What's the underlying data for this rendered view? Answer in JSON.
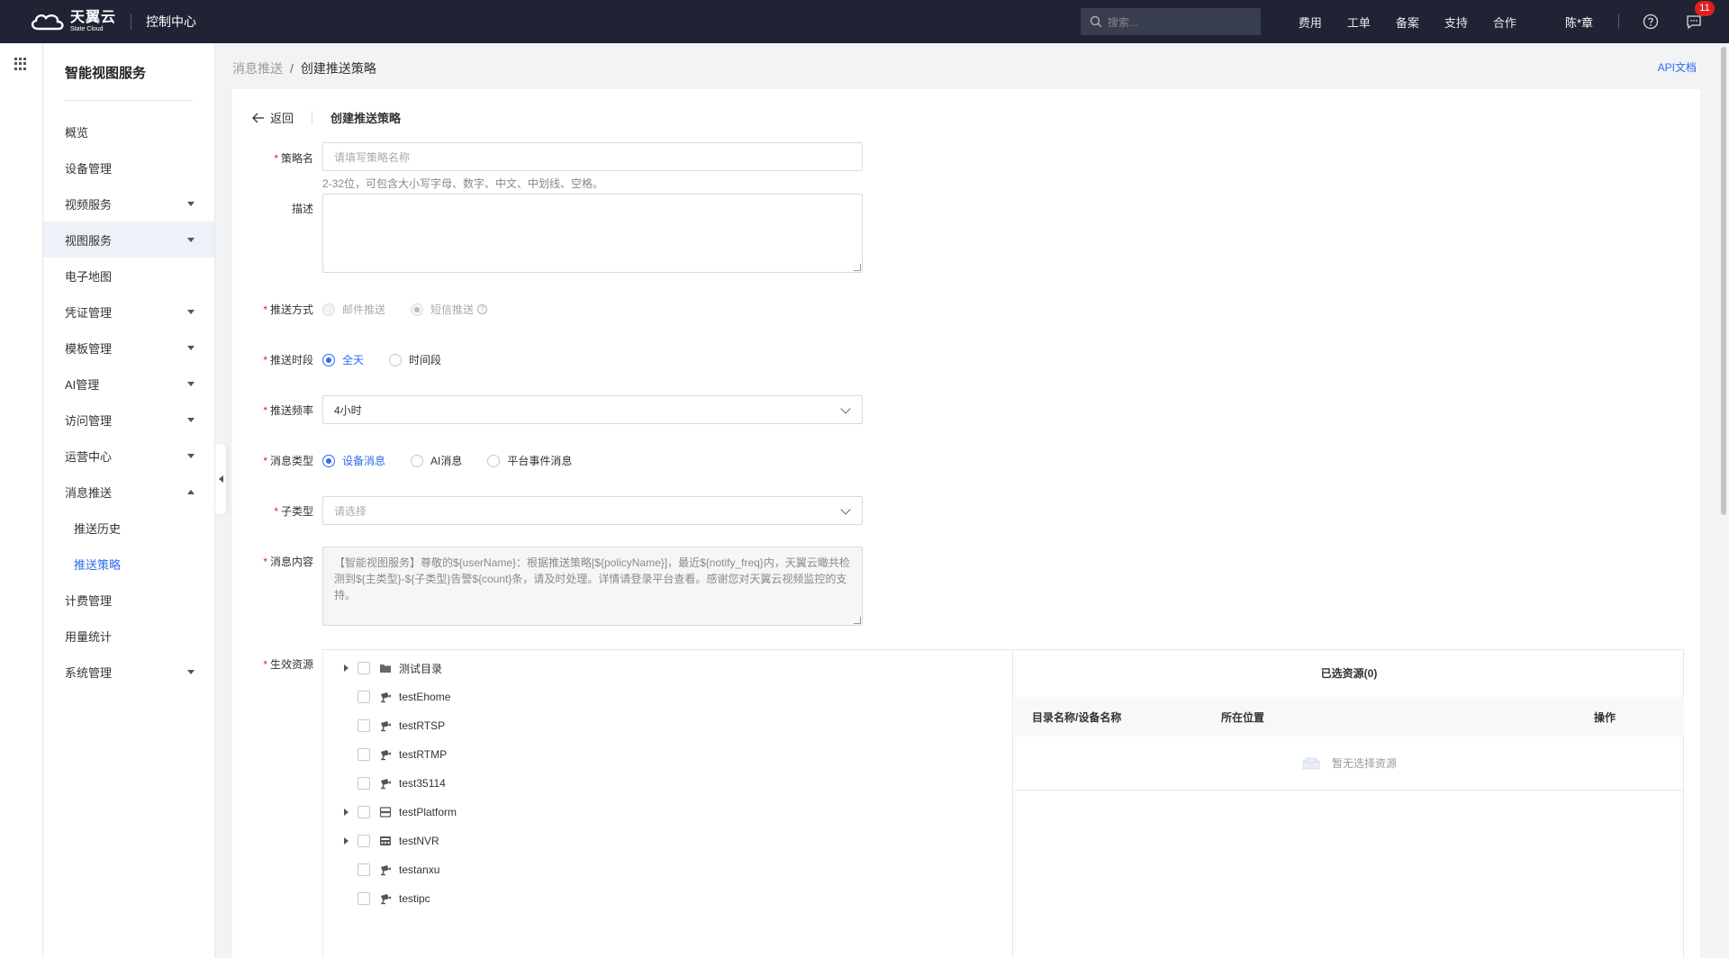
{
  "topbar": {
    "logo_cn": "天翼云",
    "logo_en": "State Cloud",
    "console_title": "控制中心",
    "search_placeholder": "搜索...",
    "links": [
      "费用",
      "工单",
      "备案",
      "支持",
      "合作"
    ],
    "user": "陈*章",
    "message_count": "11"
  },
  "sidebar": {
    "title": "智能视图服务",
    "items": [
      {
        "label": "概览",
        "caret": ""
      },
      {
        "label": "设备管理",
        "caret": ""
      },
      {
        "label": "视频服务",
        "caret": "down"
      },
      {
        "label": "视图服务",
        "caret": "down"
      },
      {
        "label": "电子地图",
        "caret": ""
      },
      {
        "label": "凭证管理",
        "caret": "down"
      },
      {
        "label": "模板管理",
        "caret": "down"
      },
      {
        "label": "AI管理",
        "caret": "down"
      },
      {
        "label": "访问管理",
        "caret": "down"
      },
      {
        "label": "运营中心",
        "caret": "down"
      },
      {
        "label": "消息推送",
        "caret": "up"
      },
      {
        "label": "推送历史",
        "caret": ""
      },
      {
        "label": "推送策略",
        "caret": ""
      },
      {
        "label": "计费管理",
        "caret": ""
      },
      {
        "label": "用量统计",
        "caret": ""
      },
      {
        "label": "系统管理",
        "caret": "down"
      }
    ]
  },
  "breadcrumb": {
    "parent": "消息推送",
    "sep": "/",
    "current": "创建推送策略"
  },
  "api_doc": "API文档",
  "form": {
    "back_label": "返回",
    "title": "创建推送策略",
    "name_label": "策略名",
    "name_placeholder": "请填写策略名称",
    "name_hint": "2-32位，可包含大小写字母、数字、中文、中划线、空格。",
    "desc_label": "描述",
    "method_label": "推送方式",
    "method_options": [
      "邮件推送",
      "短信推送"
    ],
    "period_label": "推送时段",
    "period_options": [
      "全天",
      "时间段"
    ],
    "freq_label": "推送频率",
    "freq_value": "4小时",
    "type_label": "消息类型",
    "type_options": [
      "设备消息",
      "AI消息",
      "平台事件消息"
    ],
    "subtype_label": "子类型",
    "subtype_placeholder": "请选择",
    "content_label": "消息内容",
    "content_text": "【智能视图服务】尊敬的${userName}：根据推送策略[${policyName}]，最近${notify_freq}内，天翼云瞰共检测到${主类型}-${子类型}告警${count}条，请及时处理。详情请登录平台查看。感谢您对天翼云视频监控的支持。",
    "resource_label": "生效资源"
  },
  "tree": [
    {
      "label": "测试目录",
      "expandable": true,
      "icon": "folder-icon"
    },
    {
      "label": "testEhome",
      "expandable": false,
      "icon": "camera-icon"
    },
    {
      "label": "testRTSP",
      "expandable": false,
      "icon": "camera-icon"
    },
    {
      "label": "testRTMP",
      "expandable": false,
      "icon": "camera-icon"
    },
    {
      "label": "test35114",
      "expandable": false,
      "icon": "camera-icon"
    },
    {
      "label": "testPlatform",
      "expandable": true,
      "icon": "server-icon"
    },
    {
      "label": "testNVR",
      "expandable": true,
      "icon": "nvr-icon"
    },
    {
      "label": "testanxu",
      "expandable": false,
      "icon": "camera-icon"
    },
    {
      "label": "testipc",
      "expandable": false,
      "icon": "camera-icon"
    }
  ],
  "selected": {
    "title": "已选资源(0)",
    "col_name": "目录名称/设备名称",
    "col_location": "所在位置",
    "col_action": "操作",
    "empty_text": "暂无选择资源"
  },
  "colors": {
    "accent": "#2f6bef",
    "topbar": "#1f2333",
    "required": "#e02020"
  }
}
